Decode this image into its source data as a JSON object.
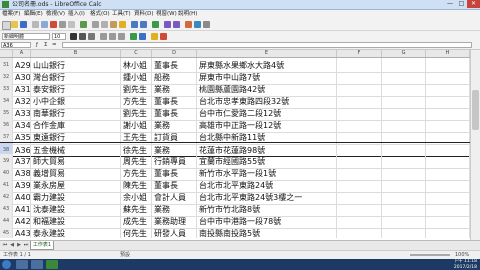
{
  "window": {
    "title": "公司名冊.ods - LibreOffice Calc",
    "minimize": "—",
    "maximize": "□",
    "close": "✕"
  },
  "menu": [
    "檔案(F)",
    "編輯(E)",
    "檢視(V)",
    "插入(I)",
    "格式(O)",
    "工具(T)",
    "資料(D)",
    "視窗(W)",
    "說明(H)"
  ],
  "toolbar": {
    "font_name": "新細明體",
    "font_size": "10",
    "icons": [
      "new-icon",
      "open-icon",
      "save-icon",
      "mail-icon",
      "edit-icon",
      "pdf-icon",
      "print-icon",
      "preview-icon",
      "spellcheck-icon",
      "cut-icon",
      "copy-icon",
      "paste-icon",
      "format-paintbrush-icon",
      "undo-icon",
      "redo-icon",
      "hyperlink-icon",
      "sort-ascending-icon",
      "sort-descending-icon",
      "chart-icon",
      "navigator-icon",
      "zoom-icon"
    ],
    "accent_colors": [
      "#3a6fc4",
      "#d04a3a",
      "#e0b020",
      "#3a9a4a",
      "#7a5ac0"
    ]
  },
  "formula_bar": {
    "cell_ref": "A36",
    "content": ""
  },
  "columns": [
    "",
    "A",
    "B",
    "C",
    "D",
    "E",
    "F",
    "G",
    "H"
  ],
  "rows": [
    {
      "num": "31",
      "id": "A29",
      "name": "山山銀行",
      "contact": "林小姐",
      "title": "董事長",
      "address": "屏東縣水果鄉水大路4號"
    },
    {
      "num": "32",
      "id": "A30",
      "name": "灣台銀行",
      "contact": "鍾小姐",
      "title": "船務",
      "address": "屏東市中山路7號"
    },
    {
      "num": "33",
      "id": "A31",
      "name": "泰安銀行",
      "contact": "劉先生",
      "title": "業務",
      "address": "桃園縣蘆園路42號"
    },
    {
      "num": "34",
      "id": "A32",
      "name": "小中企銀",
      "contact": "方先生",
      "title": "董事長",
      "address": "台北市忠孝東路四段32號"
    },
    {
      "num": "35",
      "id": "A33",
      "name": "南華銀行",
      "contact": "劉先生",
      "title": "董事長",
      "address": "台中市仁愛路二段12號"
    },
    {
      "num": "36",
      "id": "A34",
      "name": "合作金庫",
      "contact": "謝小姐",
      "title": "業務",
      "address": "高雄市中正路一段12號"
    },
    {
      "num": "37",
      "id": "A35",
      "name": "東遠銀行",
      "contact": "王先生",
      "title": "訂貨員",
      "address": "台北縣中新路11號"
    },
    {
      "num": "38",
      "id": "A36",
      "name": "五金機械",
      "contact": "徐先生",
      "title": "業務",
      "address": "花蓮市花蓮路98號",
      "selected": true
    },
    {
      "num": "39",
      "id": "A37",
      "name": "師大貿易",
      "contact": "周先生",
      "title": "行銷專員",
      "address": "宜蘭市經國路55號"
    },
    {
      "num": "40",
      "id": "A38",
      "name": "義增貿易",
      "contact": "方先生",
      "title": "董事長",
      "address": "新竹市水平路一段1號"
    },
    {
      "num": "41",
      "id": "A39",
      "name": "業永房屋",
      "contact": "陳先生",
      "title": "董事長",
      "address": "台北市北平東路24號"
    },
    {
      "num": "42",
      "id": "A40",
      "name": "霸力建設",
      "contact": "余小姐",
      "title": "會計人員",
      "address": "台北市北平東路24號3樓之一"
    },
    {
      "num": "43",
      "id": "A41",
      "name": "沈泰建設",
      "contact": "蘇先生",
      "title": "業務",
      "address": "新竹市竹北路8號"
    },
    {
      "num": "44",
      "id": "A42",
      "name": "和福建設",
      "contact": "成先生",
      "title": "業務助理",
      "address": "台中市中港路一段78號"
    },
    {
      "num": "45",
      "id": "A43",
      "name": "泰永建設",
      "contact": "何先生",
      "title": "研發人員",
      "address": "南投縣南投路5號"
    }
  ],
  "sheet_tab": "工作表1",
  "status": {
    "sheet_position": "工作表 1 / 1",
    "style": "預設",
    "zoom": "100%"
  },
  "taskbar": {
    "time": "下午 11:18",
    "date": "2017/2/18"
  }
}
